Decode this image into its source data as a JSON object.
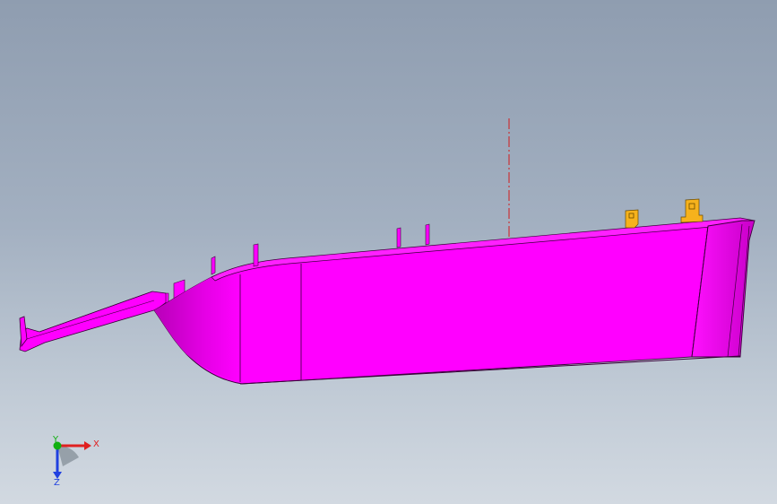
{
  "viewport": {
    "background_top": "#8f9db0",
    "background_bottom": "#d2d9e1"
  },
  "model": {
    "body_color": "#ff00ff",
    "edge_color": "#3a003a",
    "tab_color": "#f6b21c",
    "centerline_color": "#d21a1a"
  },
  "triad": {
    "x_label": "X",
    "y_label": "Y",
    "z_label": "Z",
    "x_color": "#e02020",
    "y_color": "#10b010",
    "z_color": "#2040e0"
  }
}
